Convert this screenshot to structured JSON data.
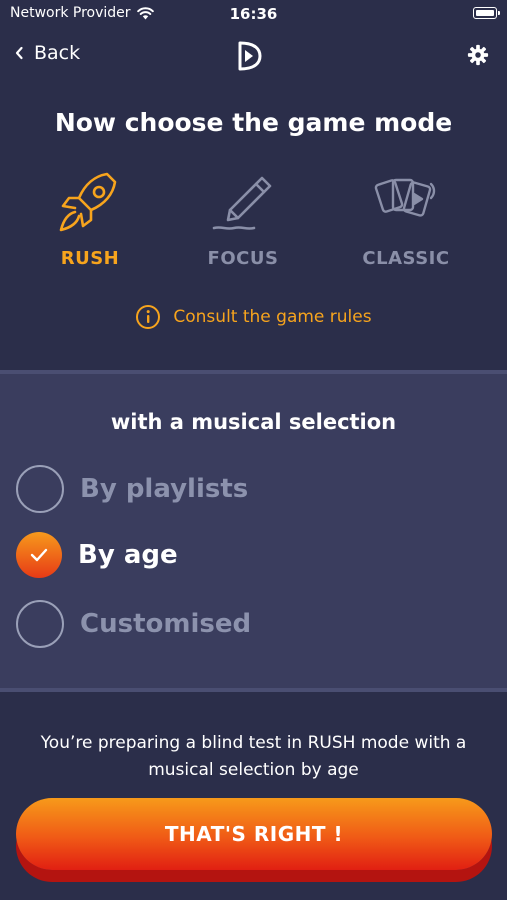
{
  "status": {
    "carrier": "Network Provider",
    "time": "16:36"
  },
  "nav": {
    "back_label": "Back"
  },
  "title": "Now choose the game mode",
  "modes": [
    {
      "label": "RUSH",
      "active": true
    },
    {
      "label": "FOCUS",
      "active": false
    },
    {
      "label": "CLASSIC",
      "active": false
    }
  ],
  "rules_link": "Consult the game rules",
  "subtitle": "with a musical selection",
  "options": [
    {
      "label": "By playlists",
      "selected": false
    },
    {
      "label": "By age",
      "selected": true
    },
    {
      "label": "Customised",
      "selected": false
    }
  ],
  "summary": "You’re preparing a blind test in RUSH mode with a musical selection  by age",
  "cta_label": "THAT'S RIGHT !",
  "colors": {
    "background": "#2b2e4a",
    "panel": "#3a3d5e",
    "accent": "#f7a41d",
    "cta_start": "#f79a1a",
    "cta_end": "#e11f12",
    "inactive": "#8a8fa8"
  }
}
